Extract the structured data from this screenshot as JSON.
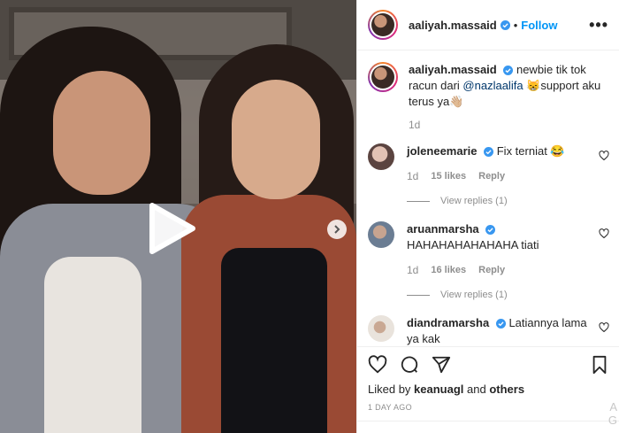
{
  "post": {
    "author": "aaliyah.massaid",
    "follow_label": "Follow",
    "more_label": "•••",
    "caption": {
      "username": "aaliyah.massaid",
      "text_before": " newbie tik tok racun dari ",
      "mention": "@nazlaalifa",
      "text_after": " 😸support aku terus ya👋🏼",
      "time": "1d"
    },
    "comments": [
      {
        "username": "joleneemarie",
        "text": " Fix terniat 😂",
        "time": "1d",
        "likes": "15 likes",
        "reply_label": "Reply",
        "view_replies": "View replies (1)",
        "avatar_color": "#d9b3a6"
      },
      {
        "username": "aruanmarsha",
        "text": "HAHAHAHAHAHAHA tiati",
        "time": "1d",
        "likes": "16 likes",
        "reply_label": "Reply",
        "view_replies": "View replies (1)",
        "avatar_color": "#7e8fa6"
      },
      {
        "username": "diandramarsha",
        "text": " Latiannya lama ya kak",
        "avatar_color": "#b4a89f"
      }
    ],
    "liked_by_prefix": "Liked by ",
    "liked_by_user": "keanuagl",
    "liked_by_and": " and ",
    "liked_by_others": "others",
    "date": "1 DAY AGO",
    "watermark": "A\nG"
  },
  "colors": {
    "accent": "#0095f6",
    "verified": "#3897f0",
    "muted": "#8e8e8e"
  },
  "icons": [
    "verified-badge-icon",
    "more-options-icon",
    "play-icon",
    "next-arrow-icon",
    "heart-icon",
    "comment-icon",
    "share-icon",
    "bookmark-icon"
  ]
}
